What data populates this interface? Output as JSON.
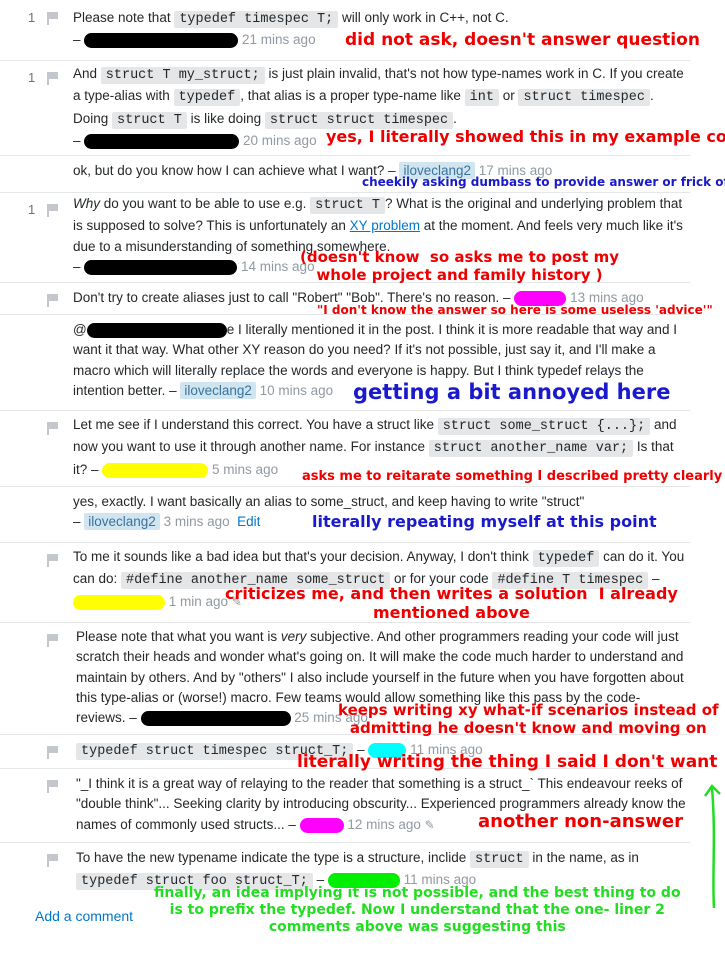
{
  "comments": [
    {
      "score": "1",
      "t1": "Please note that ",
      "code1": "typedef timespec T;",
      "t2": " will only work in C++, not C.",
      "dash": "– ",
      "time": "21 mins ago"
    },
    {
      "score": "1",
      "t1": "And ",
      "code1": "struct T my_struct;",
      "t2": " is just plain invalid, that's not how type-names work in C. If you create a type-alias with ",
      "code2": "typedef",
      "t3": ", that alias is a proper type-name like ",
      "code3": "int",
      "t4": " or ",
      "code4": "struct timespec",
      "t5": ". Doing ",
      "code5": "struct T",
      "t6": " is like doing ",
      "code6": "struct struct timespec",
      "t7": ".",
      "dash": "– ",
      "time": "20 mins ago"
    },
    {
      "t1": "ok, but do you know how I can achieve what I want? – ",
      "user": "iloveclang2",
      "time": "17 mins ago"
    },
    {
      "score": "1",
      "em": "Why",
      "t1": " do you want to be able to use e.g. ",
      "code1": "struct T",
      "t2": "? What is the original and underlying problem that is supposed to solve? This is unfortunately an ",
      "link": "XY problem",
      "t3": " at the moment. And feels very much like it's due to a misunderstanding of something somewhere.",
      "dash": "– ",
      "time": "14 mins ago"
    },
    {
      "t1": "Don't try to create aliases just to call \"Robert\" \"Bob\". There's no reason. – ",
      "time": "13 mins ago"
    },
    {
      "at": "@",
      "t1": "e I literally mentioned it in the post. I think it is more readable that way and I want it that way. What other XY reason do you need? If it's not possible, just say it, and I'll make a macro which will literally replace the words and everyone is happy. But I think typedef relays the intention better. – ",
      "user": "iloveclang2",
      "time": "10 mins ago"
    },
    {
      "t1": "Let me see if I understand this correct. You have a struct like ",
      "code1": "struct some_struct {...};",
      "t2": " and now you want to use it through another name. For instance ",
      "code2": "struct another_name var;",
      "t3": " Is that it? – ",
      "time": "5 mins ago"
    },
    {
      "t1": "yes, exactly. I want basically an alias to some_struct, and keep having to write \"struct\"",
      "dash": "– ",
      "user": "iloveclang2",
      "time": "3 mins ago",
      "edit": "Edit"
    },
    {
      "t1": "To me it sounds like a bad idea but that's your decision. Anyway, I don't think ",
      "code1": "typedef",
      "t2": " can do it. You can do: ",
      "code2": "#define  another_name some_struct",
      "t3": " or for your code ",
      "code3": "#define T timespec",
      "dash": " – ",
      "time": "1 min ago"
    },
    {
      "t1": "Please note that what you want is ",
      "em": "very",
      "t2": " subjective. And other programmers reading your code will just scratch their heads and wonder what's going on. It will make the code much harder to understand and maintain by others. And by \"others\" I also include yourself in the future when you have forgotten about this type-alias or (worse!) macro. Few teams would allow something like this pass by the code-reviews. – ",
      "time": "25 mins ago"
    },
    {
      "code1": "typedef struct timespec struct_T;",
      "dash": " – ",
      "time": "11 mins ago"
    },
    {
      "t1": "\"_I think it is a great way of relaying to the reader that something is a struct_` This endeavour reeks of \"double think\"... Seeking clarity by introducing obscurity... Experienced programmers already know the names of commonly used structs... – ",
      "time": "12 mins ago"
    },
    {
      "t1": "To have the new typename indicate the type is a structure, inclide ",
      "code1": "struct",
      "t2": " in the name, as in ",
      "code2": "typedef struct foo struct_T;",
      "dash": " – ",
      "time": "11 mins ago"
    }
  ],
  "annotations": {
    "a1": "did not ask, doesn't answer question",
    "a2": "yes, I literally showed this in my example code",
    "a3": "cheekily asking dumbass to provide answer or frick off",
    "a4": "(doesn't know  so asks me to post my\nwhole project and family history )",
    "a5": "\"I don't know the answer so here is some useless 'advice'\"",
    "a6": "getting a bit annoyed here",
    "a7": "asks me to reitarate something I described pretty clearly",
    "a8": "literally repeating myself at this point",
    "a9": "criticizes me, and then writes a solution  I already\nmentioned above",
    "a10": "keeps writing xy what-if scenarios instead of\nadmitting he doesn't know and moving on",
    "a11": "literally writing the thing I said I don't want",
    "a12": "another non-answer",
    "a13": "finally, an idea implying it is not possible, and the best thing to do\nis to prefix the typedef. Now I understand that the one- liner 2\ncomments above was suggesting this"
  },
  "add_comment": "Add a comment",
  "colors": {
    "annotation_red": "#ee0000",
    "annotation_blue": "#1a1acc",
    "annotation_green": "#22dd22",
    "link": "#0077cc",
    "user_chip_bg": "#d1e5f1"
  }
}
